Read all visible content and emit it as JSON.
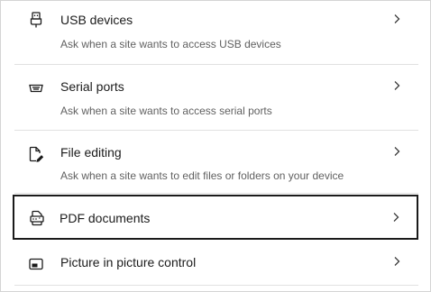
{
  "items": [
    {
      "title": "USB devices",
      "description": "Ask when a site wants to access USB devices",
      "icon": "usb-icon"
    },
    {
      "title": "Serial ports",
      "description": "Ask when a site wants to access serial ports",
      "icon": "serial-port-icon"
    },
    {
      "title": "File editing",
      "description": "Ask when a site wants to edit files or folders on your device",
      "icon": "file-edit-icon"
    },
    {
      "title": "PDF documents",
      "description": "",
      "icon": "pdf-icon"
    },
    {
      "title": "Picture in picture control",
      "description": "",
      "icon": "picture-in-picture-icon"
    }
  ],
  "colors": {
    "title": "#1b1b1b",
    "description": "#616161",
    "divider": "#e1e1e1",
    "focus_outline": "#1a1a1a"
  }
}
